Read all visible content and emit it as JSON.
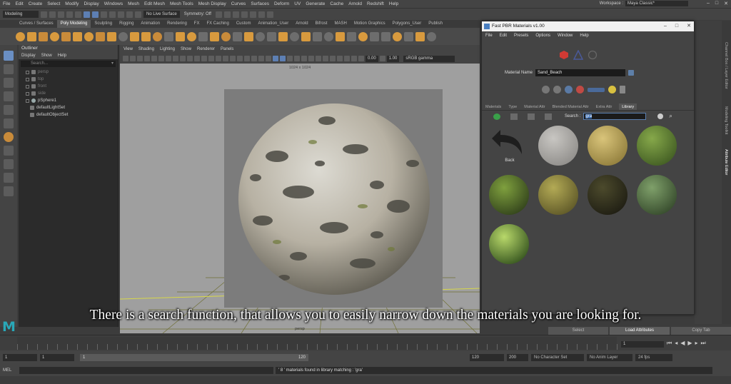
{
  "menubar": {
    "items": [
      "File",
      "Edit",
      "Create",
      "Select",
      "Modify",
      "Display",
      "Windows",
      "Mesh",
      "Edit Mesh",
      "Mesh Tools",
      "Mesh Display",
      "Curves",
      "Surfaces",
      "Deform",
      "UV",
      "Generate",
      "Cache",
      "Arnold",
      "Redshift",
      "Help"
    ],
    "workspace_label": "Workspace :",
    "workspace_value": "Maya Classic*"
  },
  "statusline": {
    "mode": "Modeling",
    "live_surface": "No Live Surface",
    "symmetry": "Symmetry: Off"
  },
  "shelf": {
    "tabs": [
      "Curves / Surfaces",
      "Poly Modeling",
      "Sculpting",
      "Rigging",
      "Animation",
      "Rendering",
      "FX",
      "FX Caching",
      "Custom",
      "Animation_User",
      "Arnold",
      "Bifrost",
      "MASH",
      "Motion Graphics",
      "Polygons_User",
      "Publish"
    ],
    "active_tab": 1
  },
  "outliner": {
    "title": "Outliner",
    "menu": [
      "Display",
      "Show",
      "Help"
    ],
    "search_placeholder": "Search...",
    "items": [
      {
        "label": "persp",
        "dim": true
      },
      {
        "label": "top",
        "dim": true
      },
      {
        "label": "front",
        "dim": true
      },
      {
        "label": "side",
        "dim": true
      },
      {
        "label": "pSphere1",
        "dim": false
      },
      {
        "label": "defaultLightSet",
        "dim": false
      },
      {
        "label": "defaultObjectSet",
        "dim": false
      }
    ]
  },
  "viewport": {
    "menu": [
      "View",
      "Shading",
      "Lighting",
      "Show",
      "Renderer",
      "Panels"
    ],
    "field_a": "0.00",
    "field_b": "1.00",
    "colorspace": "sRGB gamma",
    "resolution": "1024 x 1024",
    "camera": "persp"
  },
  "pbr_window": {
    "title": "Fast PBR Materials v1.00",
    "menu": [
      "File",
      "Edit",
      "Presets",
      "Options",
      "Window",
      "Help"
    ],
    "material_name_label": "Material Name",
    "material_name_value": "Sand_Beach",
    "tabs": [
      "Materials",
      "Type",
      "Material Attr",
      "Blended Material Attr",
      "Extra Attr",
      "Library"
    ],
    "active_tab": 5,
    "search_label": "Search :",
    "search_value": "gra",
    "back_label": "Back",
    "materials": [
      {
        "color_a": "#c8c6c2",
        "color_b": "#8d8b88"
      },
      {
        "color_a": "#d9c47a",
        "color_b": "#8e7b3a"
      },
      {
        "color_a": "#86a84a",
        "color_b": "#3f5a22"
      },
      {
        "color_a": "#7fa03e",
        "color_b": "#2f3f1a"
      },
      {
        "color_a": "#b3aa55",
        "color_b": "#5b5526"
      },
      {
        "color_a": "#4c4a2c",
        "color_b": "#1d1c12"
      },
      {
        "color_a": "#7fa06a",
        "color_b": "#33472a"
      },
      {
        "color_a": "#b8d86a",
        "color_b": "#31501c"
      }
    ]
  },
  "attribute_editor": {
    "tabs": [
      "Channel Box / Layer Editor",
      "Modeling Toolkit",
      "Attribute Editor"
    ],
    "buttons": [
      "Select",
      "Load Attributes",
      "Copy Tab"
    ]
  },
  "timeline": {
    "current_frame": "1"
  },
  "range": {
    "start": "1",
    "playback_start": "1",
    "range_start": "1",
    "range_end": "120",
    "playback_end": "120",
    "end": "200",
    "character_set": "No Character Set",
    "anim_layer": "No Anim Layer",
    "fps": "24 fps"
  },
  "mel": {
    "label": "MEL",
    "result": "' 8 ' materials found in library matching : 'gra'"
  },
  "caption": "There is a search function, that allows you to easily narrow down the materials you are looking for.",
  "colors": {
    "accent": "#5d7fb3",
    "maya_logo": "#29a8b8"
  }
}
